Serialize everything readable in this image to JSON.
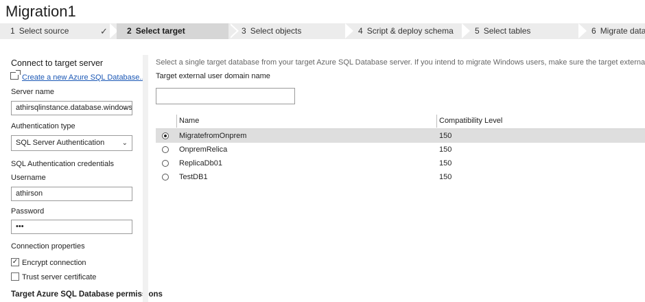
{
  "page": {
    "title": "Migration1"
  },
  "steps": [
    {
      "num": "1",
      "label": "Select source",
      "completed": true
    },
    {
      "num": "2",
      "label": "Select target",
      "active": true
    },
    {
      "num": "3",
      "label": "Select objects"
    },
    {
      "num": "4",
      "label": "Script & deploy schema"
    },
    {
      "num": "5",
      "label": "Select tables"
    },
    {
      "num": "6",
      "label": "Migrate data"
    }
  ],
  "left": {
    "header": "Connect to target server",
    "create_link": "Create a new Azure SQL Database...",
    "server_name_label": "Server name",
    "server_name_value": "athirsqlinstance.database.windows.ne",
    "auth_type_label": "Authentication type",
    "auth_type_value": "SQL Server Authentication",
    "credentials_header": "SQL Authentication credentials",
    "username_label": "Username",
    "username_value": "athirson",
    "password_label": "Password",
    "password_value": "•••",
    "conn_props_header": "Connection properties",
    "encrypt_label": "Encrypt connection",
    "encrypt_checked": true,
    "trust_label": "Trust server certificate",
    "trust_checked": false,
    "permissions_header": "Target Azure SQL Database permissions"
  },
  "main": {
    "description": "Select a single target database from your target Azure SQL Database server. If you intend to migrate Windows users, make sure the target external user domain name is set c",
    "domain_label": "Target external user domain name",
    "domain_value": "",
    "columns": {
      "name": "Name",
      "compat": "Compatibility Level"
    },
    "rows": [
      {
        "name": "MigratefromOnprem",
        "level": "150",
        "selected": true
      },
      {
        "name": "OnpremRelica",
        "level": "150"
      },
      {
        "name": "ReplicaDb01",
        "level": "150"
      },
      {
        "name": "TestDB1",
        "level": "150"
      }
    ]
  },
  "icons": {
    "step_check": "checkmark-icon",
    "dropdown": "chevron-down-icon",
    "create": "new-window-icon"
  }
}
